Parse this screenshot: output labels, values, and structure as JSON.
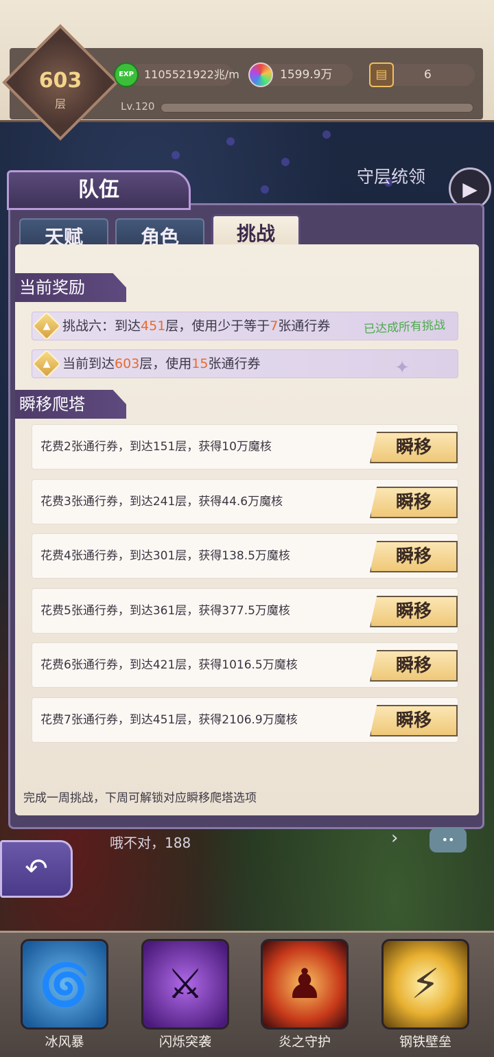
{
  "header": {
    "floor_number": "603",
    "floor_unit": "层",
    "exp_icon_label": "EXP",
    "exp_rate": "1105521922兆/m",
    "gems": "1599.9万",
    "tickets": "6",
    "level": "Lv.120"
  },
  "side": {
    "guard_label": "守层统领"
  },
  "panel": {
    "title": "队伍",
    "tabs": [
      {
        "label": "天赋"
      },
      {
        "label": "角色"
      },
      {
        "label": "挑战"
      }
    ],
    "current_reward": {
      "section_title": "当前奖励",
      "row1": {
        "prefix": "挑战六：到达",
        "floor": "451",
        "mid": "层，使用少于等于",
        "count": "7",
        "suffix": "张通行券",
        "status": "已达成所有挑战"
      },
      "row2": {
        "prefix": "当前到达",
        "floor": "603",
        "mid": "层，使用",
        "count": "15",
        "suffix": "张通行券"
      }
    },
    "teleport": {
      "section_title": "瞬移爬塔",
      "button_label": "瞬移",
      "rows": [
        {
          "text": "花费2张通行券，到达151层，获得10万魔核"
        },
        {
          "text": "花费3张通行券，到达241层，获得44.6万魔核"
        },
        {
          "text": "花费4张通行券，到达301层，获得138.5万魔核"
        },
        {
          "text": "花费5张通行券，到达361层，获得377.5万魔核"
        },
        {
          "text": "花费6张通行券，到达421层，获得1016.5万魔核"
        },
        {
          "text": "花费7张通行券，到达451层，获得2106.9万魔核"
        }
      ]
    },
    "footnote": "完成一周挑战，下周可解锁对应瞬移爬塔选项"
  },
  "chat": {
    "text": "哦不对，188"
  },
  "skills": [
    {
      "name": "冰风暴",
      "icon": "tornado-icon",
      "color": "#2a7ac8"
    },
    {
      "name": "闪烁突袭",
      "icon": "shadow-strike-icon",
      "color": "#7a3ab8"
    },
    {
      "name": "炎之守护",
      "icon": "flame-guardian-icon",
      "color": "#c83a1a"
    },
    {
      "name": "钢铁壁垒",
      "icon": "blade-icon",
      "color": "#d8a020"
    }
  ]
}
